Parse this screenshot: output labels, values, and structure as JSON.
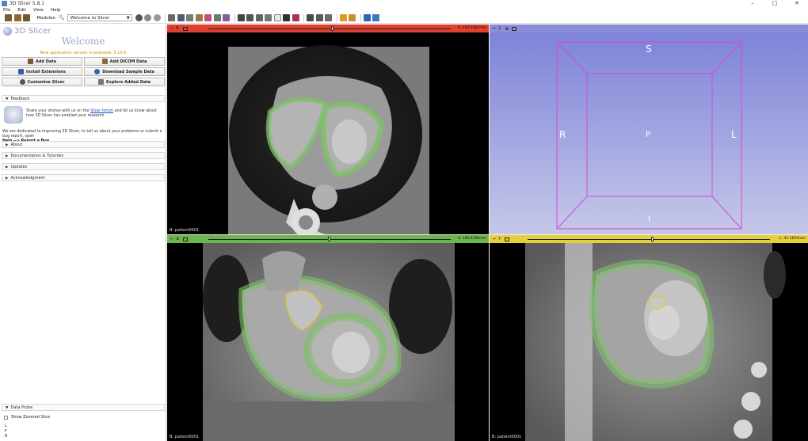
{
  "window": {
    "title": "3D Slicer 5.8.1",
    "controls": [
      "–",
      "□",
      "✕"
    ]
  },
  "menu": [
    "File",
    "Edit",
    "View",
    "Help"
  ],
  "toolbar": {
    "modules_label": "Modules:",
    "module_selected": "Welcome to Slicer"
  },
  "panel": {
    "logo_text": "3D Slicer",
    "welcome_title": "Welcome",
    "new_version": "New application version is available: 5.10.0",
    "buttons": {
      "add_data": "Add Data",
      "add_dicom": "Add DICOM Data",
      "install_ext": "Install Extensions",
      "download_sample": "Download Sample Data",
      "customize": "Customize Slicer",
      "explore": "Explore Added Data"
    },
    "sections": {
      "feedback": "Feedback",
      "about": "About",
      "docs": "Documentation & Tutorials",
      "updates": "Updates",
      "ack": "Acknowledgment",
      "data_probe": "Data Probe"
    },
    "feedback_text_1": "Share your stories with us on the",
    "feedback_link": "Slicer forum",
    "feedback_text_2": "and let us know about how 3D Slicer has enabled your research.",
    "help_text": "We are dedicated to improving 3D Slicer, to tell us about your problems or submit a bug report, open",
    "help_path": "Help --> Report a Bug",
    "show_zoomed": "Show Zoomed Slice",
    "coord_letters": [
      "L",
      "F",
      "B"
    ]
  },
  "views": {
    "red": {
      "name": "R",
      "offset": "S: 204.3987mm",
      "label": "B: patient0001",
      "color": "#e04030"
    },
    "threed": {
      "name": "1",
      "labels": {
        "top": "S",
        "left": "R",
        "center": "P",
        "right": "L",
        "bottom": "I"
      },
      "color": "#8a8ed8"
    },
    "green": {
      "name": "G",
      "offset": "A: 190.9796mm",
      "label": "B: patient0001",
      "color": "#6cb64c"
    },
    "yellow": {
      "name": "Y",
      "offset": "L: 41.2859mm",
      "label": "B: patient0001",
      "color": "#e7cf3c"
    }
  }
}
